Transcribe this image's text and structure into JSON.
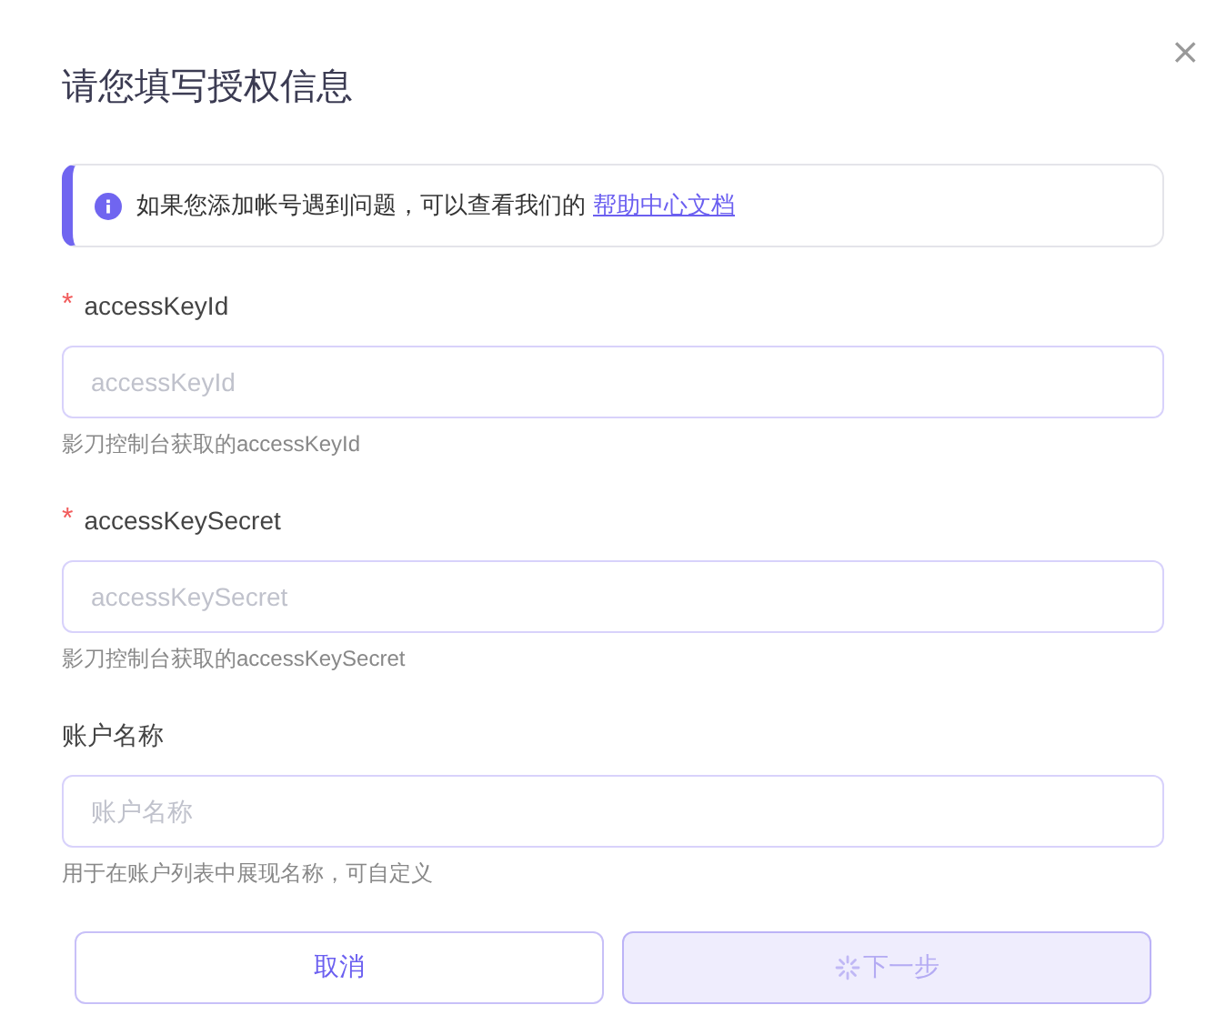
{
  "dialog": {
    "title": "请您填写授权信息",
    "close": "×"
  },
  "notice": {
    "text": "如果您添加帐号遇到问题，可以查看我们的",
    "link": "帮助中心文档"
  },
  "fields": [
    {
      "label": "accessKeyId",
      "required_mark": "*",
      "placeholder": "accessKeyId",
      "help": "影刀控制台获取的accessKeyId"
    },
    {
      "label": "accessKeySecret",
      "required_mark": "*",
      "placeholder": "accessKeySecret",
      "help": "影刀控制台获取的accessKeySecret"
    },
    {
      "label": "账户名称",
      "placeholder": "账户名称",
      "help": "用于在账户列表中展现名称，可自定义"
    }
  ],
  "buttons": [
    {
      "label": "取消",
      "kind": "secondary",
      "loading": false
    },
    {
      "label": "下一步",
      "kind": "primary",
      "loading": true
    }
  ]
}
